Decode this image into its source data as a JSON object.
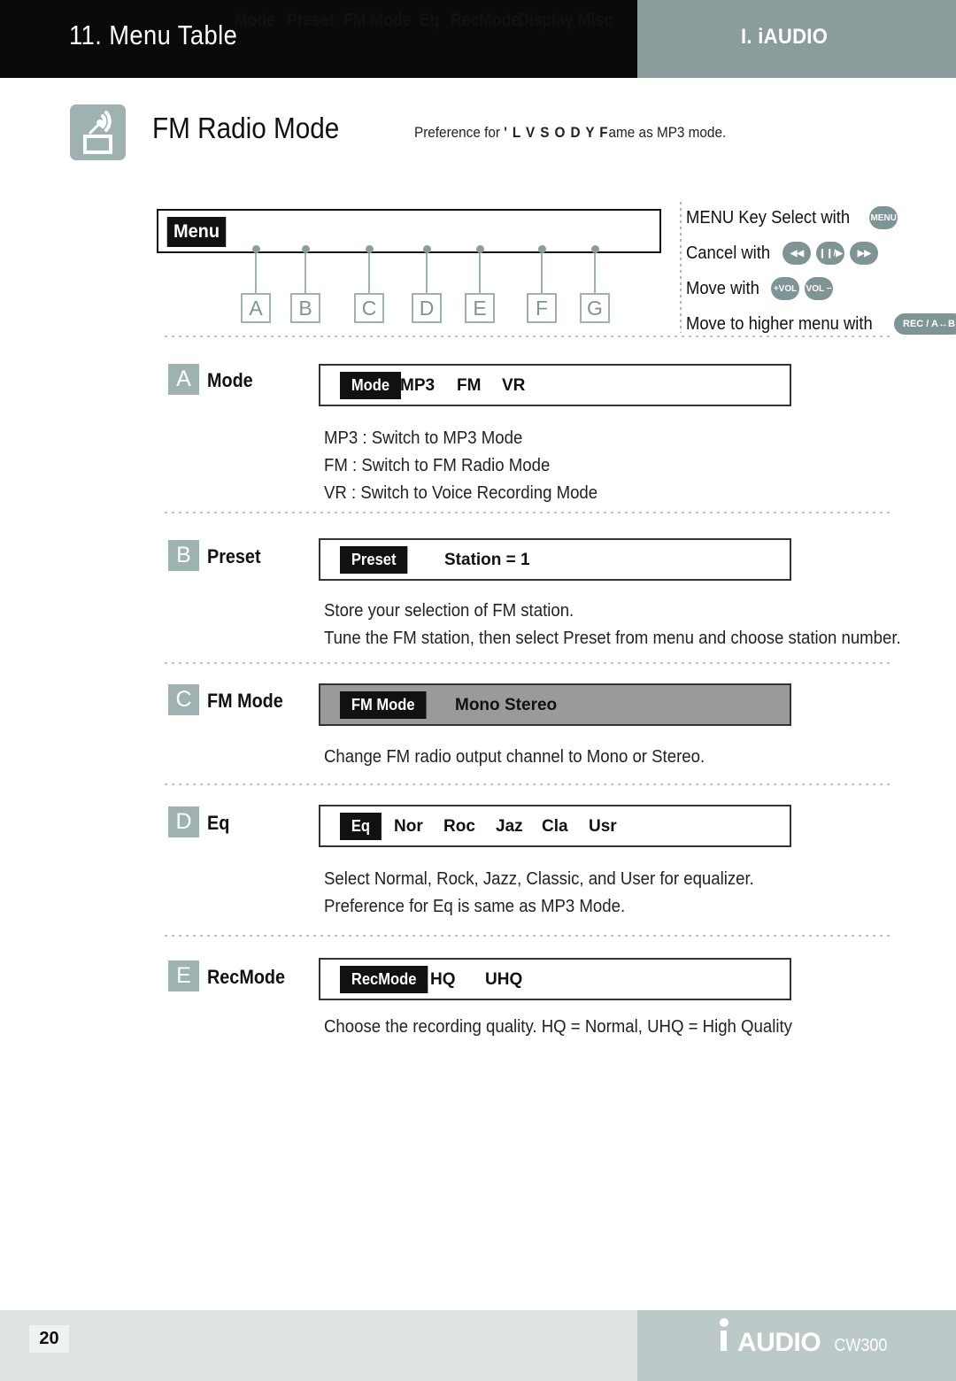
{
  "header": {
    "title": "11. Menu Table",
    "chapter": "I. iAUDIO"
  },
  "section": {
    "icon": "fm-radio-icon",
    "title": "FM Radio Mode",
    "note_prefix": "Preference for",
    "note_garbled": "' L V S O D Y F",
    "note_suffix": "ame as MP3 mode."
  },
  "menubar": {
    "badge": "Menu",
    "items": [
      {
        "label": "Mode",
        "letter": "A"
      },
      {
        "label": "Preset",
        "letter": "B"
      },
      {
        "label": "FM Mode",
        "letter": "C"
      },
      {
        "label": "Eq",
        "letter": "D"
      },
      {
        "label": "RecMode",
        "letter": "E"
      },
      {
        "label": "Display",
        "letter": "F"
      },
      {
        "label": "Misc",
        "letter": "G"
      }
    ]
  },
  "legend": {
    "rows": [
      {
        "text": "MENU Key Select with",
        "keys": [
          "MENU"
        ]
      },
      {
        "text": "Cancel with",
        "keys": [
          "◀◀",
          "❙❙/▶",
          "▶▶"
        ]
      },
      {
        "text": "Move with",
        "keys": [
          "+VOL",
          "VOL −"
        ]
      },
      {
        "text": "Move to higher menu with",
        "keys": [
          "REC / A↔B"
        ]
      }
    ]
  },
  "entries": [
    {
      "letter": "A",
      "label": "Mode",
      "lcd_tag": "Mode",
      "lcd_options": [
        "MP3",
        "FM",
        "VR"
      ],
      "lcd_filled": false,
      "descriptions": [
        "MP3 : Switch to MP3 Mode",
        "FM : Switch to FM Radio Mode",
        "VR : Switch to Voice Recording Mode"
      ]
    },
    {
      "letter": "B",
      "label": "Preset",
      "lcd_tag": "Preset",
      "lcd_options": [
        "Station = 1"
      ],
      "lcd_filled": false,
      "descriptions": [
        "Store your selection of FM station.",
        "Tune the FM station, then select Preset from menu and choose station number."
      ]
    },
    {
      "letter": "C",
      "label": "FM Mode",
      "lcd_tag": "FM Mode",
      "lcd_options": [
        "Mono",
        "Stereo"
      ],
      "lcd_filled": true,
      "descriptions": [
        "Change FM radio output channel to Mono or Stereo."
      ]
    },
    {
      "letter": "D",
      "label": "Eq",
      "lcd_tag": "Eq",
      "lcd_options": [
        "Nor",
        "Roc",
        "Jaz",
        "Cla",
        "Usr"
      ],
      "lcd_filled": false,
      "descriptions": [
        "Select Normal, Rock, Jazz, Classic, and User for equalizer.",
        "Preference for Eq is same as MP3 Mode."
      ]
    },
    {
      "letter": "E",
      "label": "RecMode",
      "lcd_tag": "RecMode",
      "lcd_options": [
        "HQ",
        "UHQ"
      ],
      "lcd_filled": false,
      "descriptions": [
        "Choose the recording quality. HQ = Normal, UHQ = High Quality"
      ]
    }
  ],
  "footer": {
    "page_number": "20",
    "logo_text": "AUDIO",
    "logo_model": "CW300"
  },
  "colors": {
    "header_black": "#0a0a0a",
    "header_gray": "#8b9c9c",
    "accent_teal": "#9fb2b2",
    "lcd_fill_gray": "#9a9a9a",
    "footer_left": "#dde3e3",
    "footer_right": "#bcc9c9"
  }
}
